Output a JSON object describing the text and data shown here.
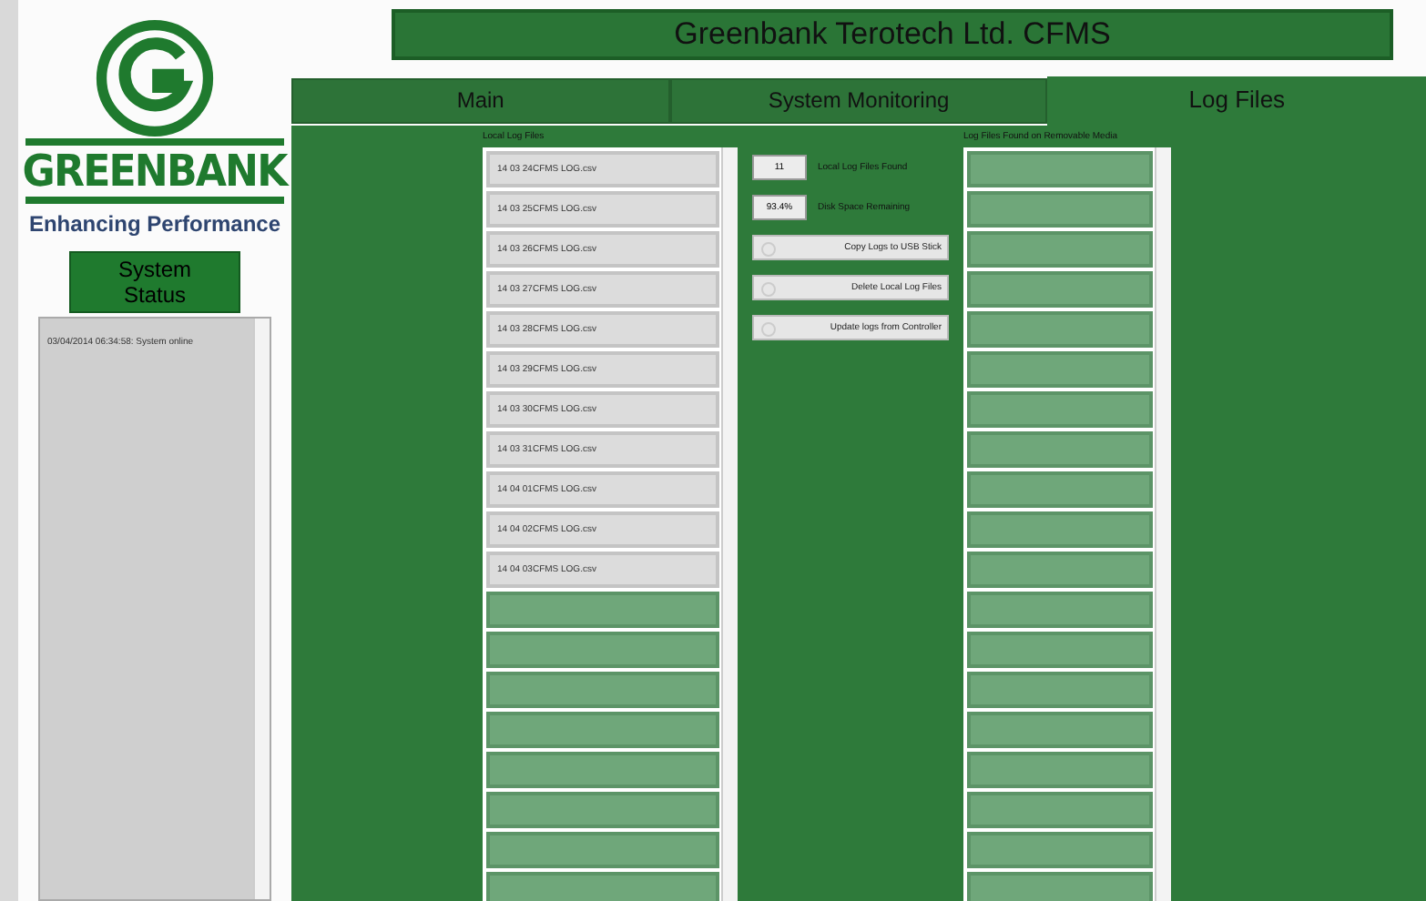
{
  "window": {
    "title": "Greenbank Terotech Ltd. CFMS"
  },
  "logo": {
    "name": "GREENBANK",
    "tagline": "Enhancing Performance"
  },
  "system_status": {
    "title": "System Status",
    "messages": [
      "03/04/2014 06:34:58: System online"
    ]
  },
  "tabs": [
    {
      "label": "Main",
      "selected": false
    },
    {
      "label": "System Monitoring",
      "selected": false
    },
    {
      "label": "Log Files",
      "selected": true
    }
  ],
  "local_log_files": {
    "label": "Local Log Files",
    "files": [
      "14 03 24CFMS LOG.csv",
      "14 03 25CFMS LOG.csv",
      "14 03 26CFMS LOG.csv",
      "14 03 27CFMS LOG.csv",
      "14 03 28CFMS LOG.csv",
      "14 03 29CFMS LOG.csv",
      "14 03 30CFMS LOG.csv",
      "14 03 31CFMS LOG.csv",
      "14 04 01CFMS LOG.csv",
      "14 04 02CFMS LOG.csv",
      "14 04 03CFMS LOG.csv"
    ]
  },
  "indicators": [
    {
      "value": "11",
      "label": "Local Log Files Found"
    },
    {
      "value": "93.4%",
      "label": "Disk Space Remaining"
    }
  ],
  "buttons": [
    "Copy Logs to USB Stick",
    "Delete Local Log Files",
    "Update logs from Controller"
  ],
  "removable_log_files": {
    "label": "Log Files Found on Removable Media"
  }
}
